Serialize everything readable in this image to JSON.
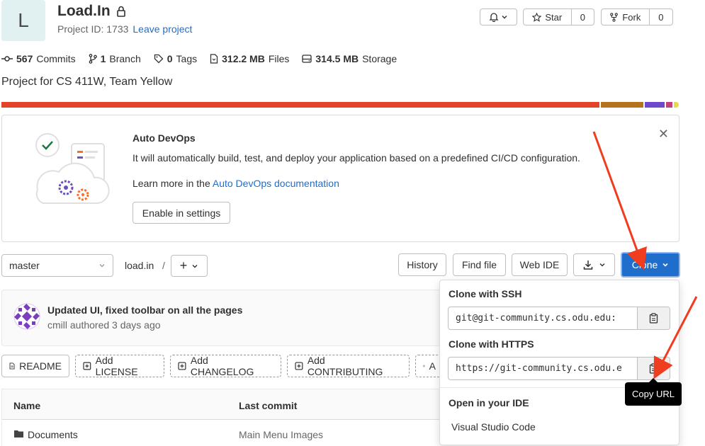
{
  "project": {
    "avatar_letter": "L",
    "title": "Load.In",
    "id_label": "Project ID: 1733",
    "leave_link": "Leave project",
    "description": "Project for CS 411W, Team Yellow"
  },
  "actions": {
    "star_label": "Star",
    "star_count": "0",
    "fork_label": "Fork",
    "fork_count": "0"
  },
  "stats": {
    "commits_count": "567",
    "commits_label": "Commits",
    "branch_count": "1",
    "branch_label": "Branch",
    "tags_count": "0",
    "tags_label": "Tags",
    "files_size": "312.2 MB",
    "files_label": "Files",
    "storage_size": "314.5 MB",
    "storage_label": "Storage"
  },
  "language_colors": [
    "#e24329",
    "#b5731d",
    "#6e49cb",
    "#c0447a",
    "#e6d84f"
  ],
  "devops": {
    "title": "Auto DevOps",
    "body": "It will automatically build, test, and deploy your application based on a predefined CI/CD configuration.",
    "learn_prefix": "Learn more in the",
    "learn_link": "Auto DevOps documentation",
    "settings_button": "Enable in settings"
  },
  "toolbar": {
    "branch": "master",
    "path": "load.in",
    "separator": "/",
    "history": "History",
    "find_file": "Find file",
    "web_ide": "Web IDE",
    "clone": "Clone"
  },
  "commit": {
    "message": "Updated UI, fixed toolbar on all the pages",
    "author_line": "cmill authored 3 days ago"
  },
  "quick_links": {
    "readme": "README",
    "license": "Add LICENSE",
    "changelog": "Add CHANGELOG",
    "contributing": "Add CONTRIBUTING",
    "truncated": "A"
  },
  "table": {
    "col_name": "Name",
    "col_last_commit": "Last commit",
    "row_name": "Documents",
    "row_commit": "Main Menu Images"
  },
  "clone_dropdown": {
    "ssh_header": "Clone with SSH",
    "ssh_url": "git@git-community.cs.odu.edu:",
    "https_header": "Clone with HTTPS",
    "https_url": "https://git-community.cs.odu.e",
    "ide_header": "Open in your IDE",
    "ide_option": "Visual Studio Code"
  },
  "tooltip": "Copy URL",
  "colors": {
    "accent_blue": "#1f75cb",
    "arrow_red": "#f03c1f"
  }
}
